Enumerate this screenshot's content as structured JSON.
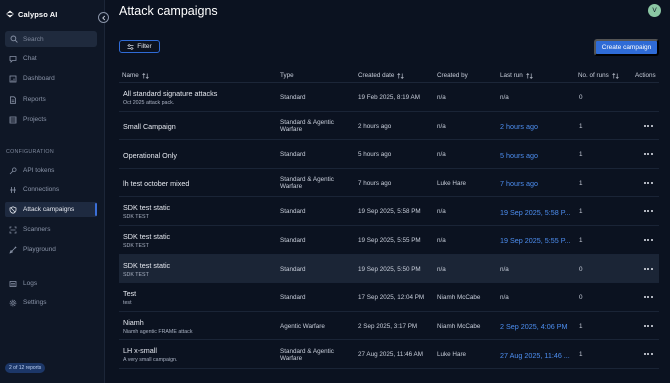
{
  "app": {
    "name": "Calypso AI"
  },
  "sidebar": {
    "search_placeholder": "Search",
    "nav": [
      {
        "label": "Chat",
        "icon": "chat-icon"
      },
      {
        "label": "Dashboard",
        "icon": "dashboard-icon"
      },
      {
        "label": "Reports",
        "icon": "reports-icon"
      },
      {
        "label": "Projects",
        "icon": "projects-icon"
      }
    ],
    "config_label": "CONFIGURATION",
    "config_nav": [
      {
        "label": "API tokens",
        "icon": "key-icon"
      },
      {
        "label": "Connections",
        "icon": "connections-icon"
      },
      {
        "label": "Attack campaigns",
        "icon": "shield-icon",
        "active": true
      },
      {
        "label": "Scanners",
        "icon": "scanner-icon"
      },
      {
        "label": "Playground",
        "icon": "playground-icon"
      }
    ],
    "bottom_nav": [
      {
        "label": "Logs",
        "icon": "logs-icon"
      },
      {
        "label": "Settings",
        "icon": "settings-icon"
      }
    ],
    "reports_badge": "2 of 12 reports"
  },
  "header": {
    "title": "Attack campaigns",
    "avatar_initial": "V"
  },
  "toolbar": {
    "filter_label": "Filter",
    "create_label": "Create campaign"
  },
  "table": {
    "columns": {
      "name": "Name",
      "type": "Type",
      "created_date": "Created date",
      "created_by": "Created by",
      "last_run": "Last run",
      "runs": "No. of runs",
      "actions": "Actions"
    },
    "rows": [
      {
        "name": "All standard signature attacks",
        "sub": "Oct 2025 attack pack.",
        "type": "Standard",
        "created": "19 Feb 2025, 8:19 AM",
        "by": "n/a",
        "last_run": "n/a",
        "last_link": false,
        "runs": "0",
        "actions": false,
        "highlight": false
      },
      {
        "name": "Small Campaign",
        "sub": "",
        "type": "Standard & Agentic Warfare",
        "created": "2 hours ago",
        "by": "n/a",
        "last_run": "2 hours ago",
        "last_link": true,
        "runs": "1",
        "actions": true,
        "highlight": false
      },
      {
        "name": "Operational Only",
        "sub": "",
        "type": "Standard",
        "created": "5 hours ago",
        "by": "n/a",
        "last_run": "5 hours ago",
        "last_link": true,
        "runs": "1",
        "actions": true,
        "highlight": false
      },
      {
        "name": "lh test october mixed",
        "sub": "",
        "type": "Standard & Agentic Warfare",
        "created": "7 hours ago",
        "by": "Luke Hare",
        "last_run": "7 hours ago",
        "last_link": true,
        "runs": "1",
        "actions": true,
        "highlight": false
      },
      {
        "name": "SDK test static",
        "sub": "SDK TEST",
        "type": "Standard",
        "created": "19 Sep 2025, 5:58 PM",
        "by": "n/a",
        "last_run": "19 Sep 2025, 5:58 P...",
        "last_link": true,
        "runs": "1",
        "actions": true,
        "highlight": false
      },
      {
        "name": "SDK test static",
        "sub": "SDK TEST",
        "type": "Standard",
        "created": "19 Sep 2025, 5:55 PM",
        "by": "n/a",
        "last_run": "19 Sep 2025, 5:55 P...",
        "last_link": true,
        "runs": "1",
        "actions": true,
        "highlight": false
      },
      {
        "name": "SDK test static",
        "sub": "SDK TEST",
        "type": "Standard",
        "created": "19 Sep 2025, 5:50 PM",
        "by": "n/a",
        "last_run": "n/a",
        "last_link": false,
        "runs": "0",
        "actions": true,
        "highlight": true
      },
      {
        "name": "Test",
        "sub": "test",
        "type": "Standard",
        "created": "17 Sep 2025, 12:04 PM",
        "by": "Niamh McCabe",
        "last_run": "n/a",
        "last_link": false,
        "runs": "0",
        "actions": true,
        "highlight": false
      },
      {
        "name": "Niamh",
        "sub": "Niamh agentic FRAME attack",
        "type": "Agentic Warfare",
        "created": "2 Sep 2025, 3:17 PM",
        "by": "Niamh McCabe",
        "last_run": "2 Sep 2025, 4:06 PM",
        "last_link": true,
        "runs": "1",
        "actions": true,
        "highlight": false
      },
      {
        "name": "LH x-small",
        "sub": "A very small campaign.",
        "type": "Standard & Agentic Warfare",
        "created": "27 Aug 2025, 11:46 AM",
        "by": "Luke Hare",
        "last_run": "27 Aug 2025, 11:46 ...",
        "last_link": true,
        "runs": "1",
        "actions": true,
        "highlight": false
      }
    ]
  }
}
